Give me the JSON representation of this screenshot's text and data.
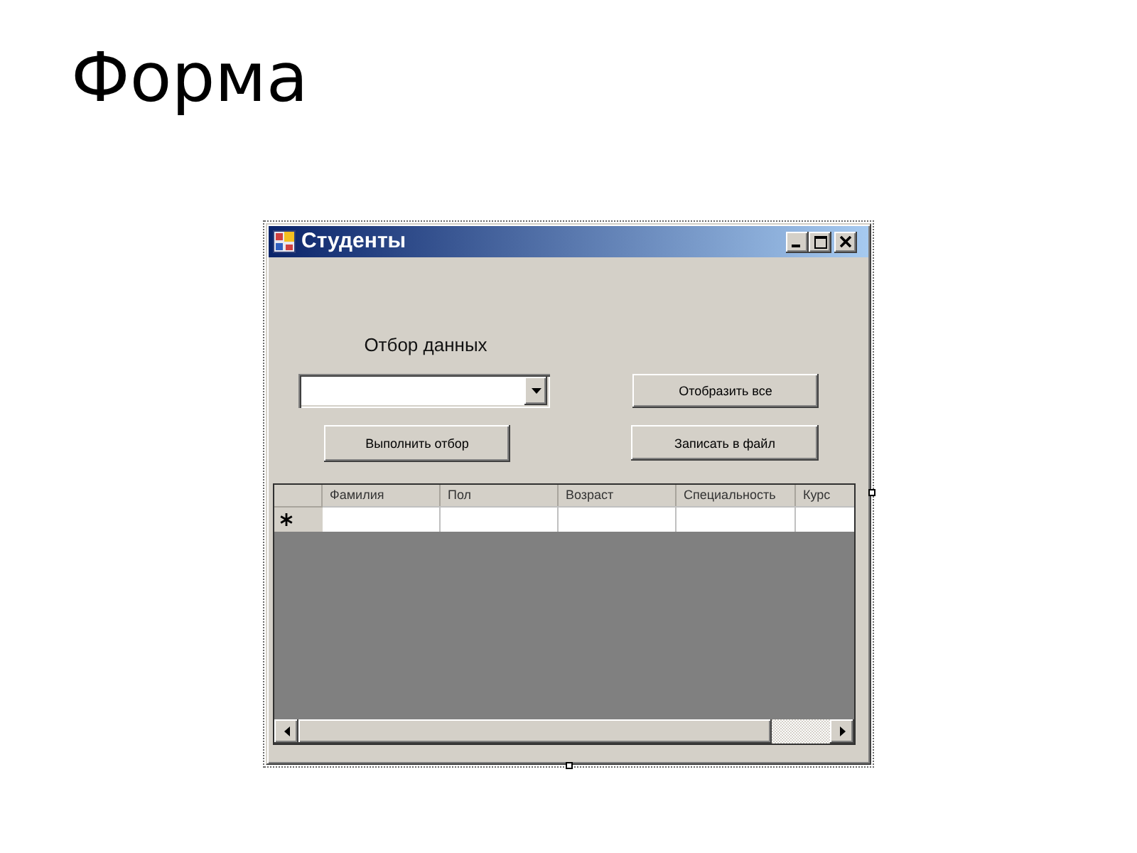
{
  "slide": {
    "title": "Форма"
  },
  "window": {
    "title": "Студенты"
  },
  "filter": {
    "label": "Отбор данных"
  },
  "buttons": [
    "Отобразить все",
    "Выполнить отбор",
    "Записать в файл"
  ],
  "grid": {
    "columns": [
      "Фамилия",
      "Пол",
      "Возраст",
      "Специальность",
      "Курс"
    ]
  }
}
